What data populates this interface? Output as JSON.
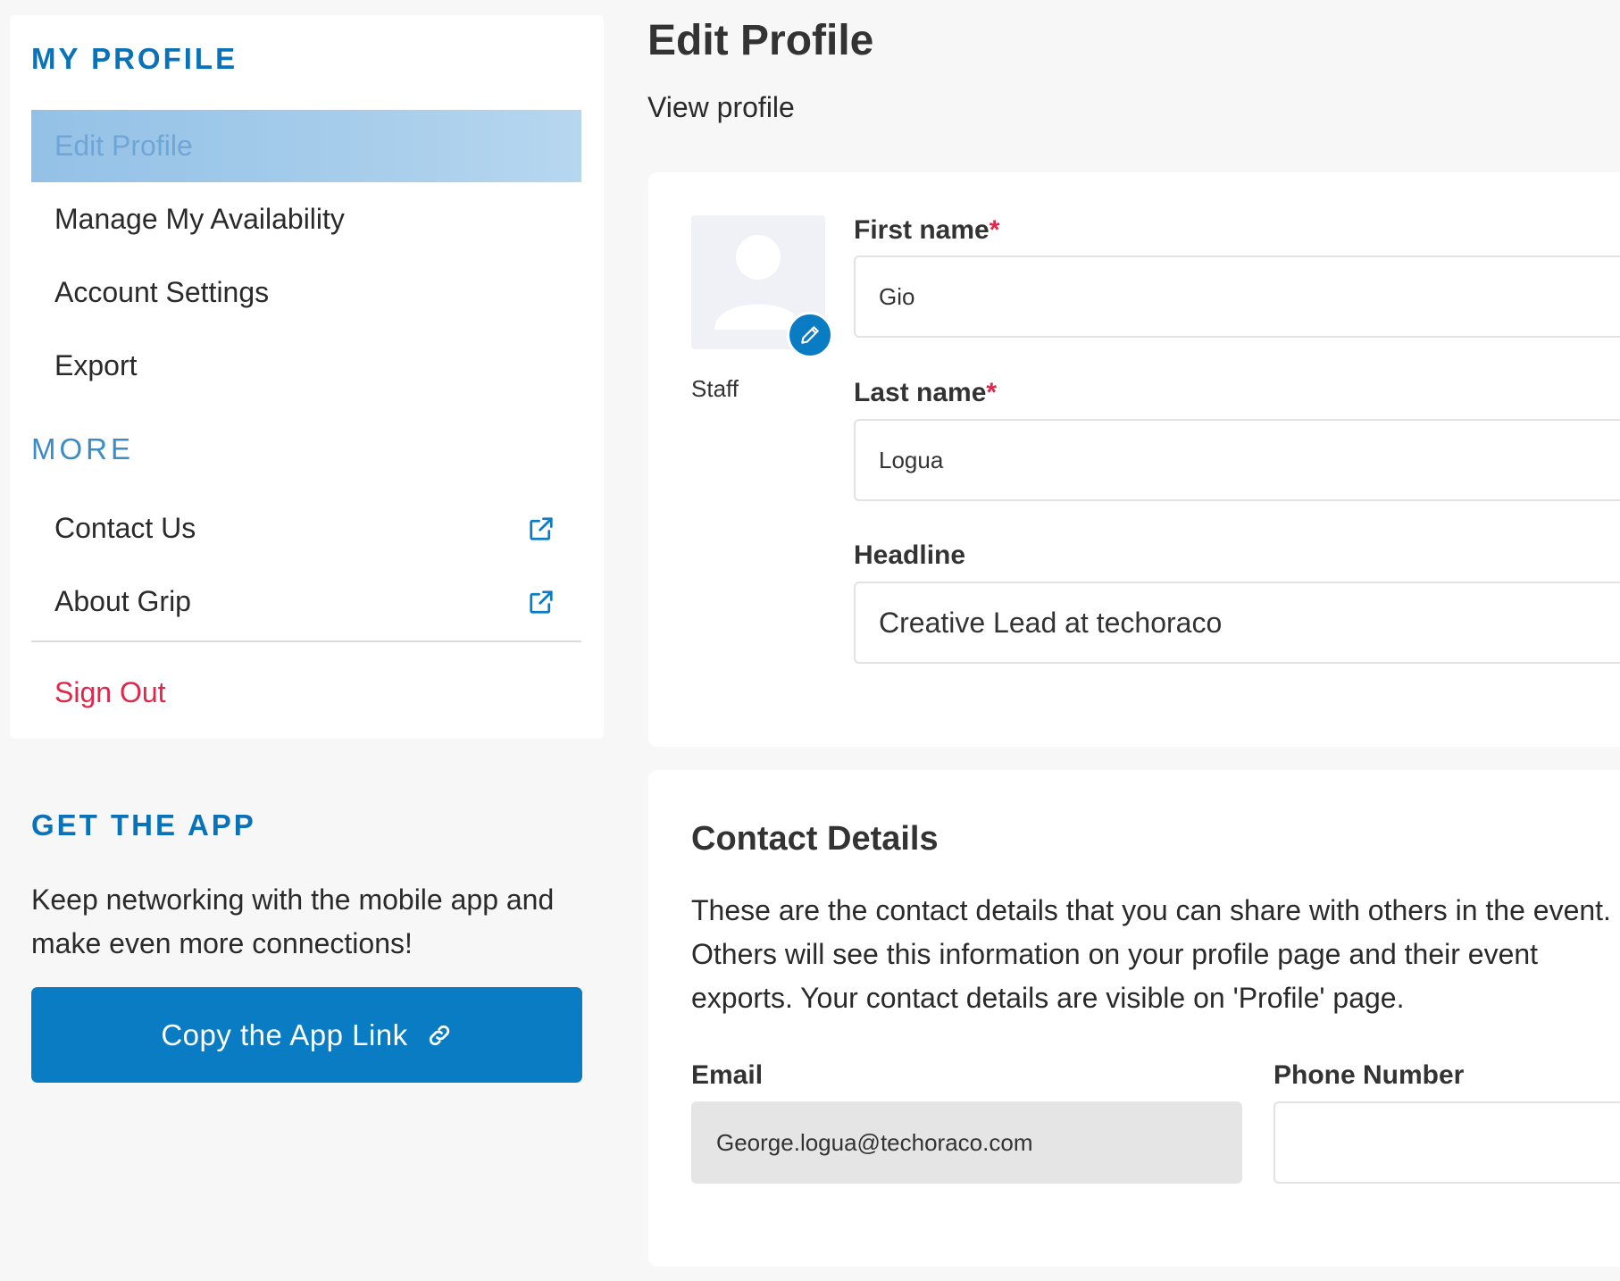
{
  "sidebar": {
    "heading": "MY PROFILE",
    "items": [
      {
        "label": "Edit Profile"
      },
      {
        "label": "Manage My Availability"
      },
      {
        "label": "Account Settings"
      },
      {
        "label": "Export"
      }
    ],
    "more_heading": "MORE",
    "more_items": [
      {
        "label": "Contact Us",
        "icon": "external-link-icon"
      },
      {
        "label": "About Grip",
        "icon": "external-link-icon"
      }
    ],
    "sign_out": "Sign Out"
  },
  "app_promo": {
    "heading": "GET THE APP",
    "text": "Keep networking with the mobile app and make even more connections!",
    "button_label": "Copy the App Link",
    "button_icon": "link-icon"
  },
  "main": {
    "title": "Edit Profile",
    "view_profile": "View profile",
    "profile": {
      "role": "Staff",
      "first_name_label": "First name",
      "first_name_value": "Gio",
      "last_name_label": "Last name",
      "last_name_value": "Logua",
      "headline_label": "Headline",
      "headline_value": "Creative Lead at techoraco",
      "required_mark": "*"
    },
    "contact": {
      "title": "Contact Details",
      "description": "These are the contact details that you can share with others in the event. Others will see this information on your profile page and their event exports. Your contact details are visible on 'Profile' page.",
      "email_label": "Email",
      "email_value": "George.logua@techoraco.com",
      "phone_label": "Phone Number",
      "phone_value": ""
    }
  },
  "colors": {
    "accent": "#0a7cc3",
    "heading_blue": "#0a72b8",
    "danger": "#e0264a",
    "active_item_bg": "#a7cdeb"
  }
}
